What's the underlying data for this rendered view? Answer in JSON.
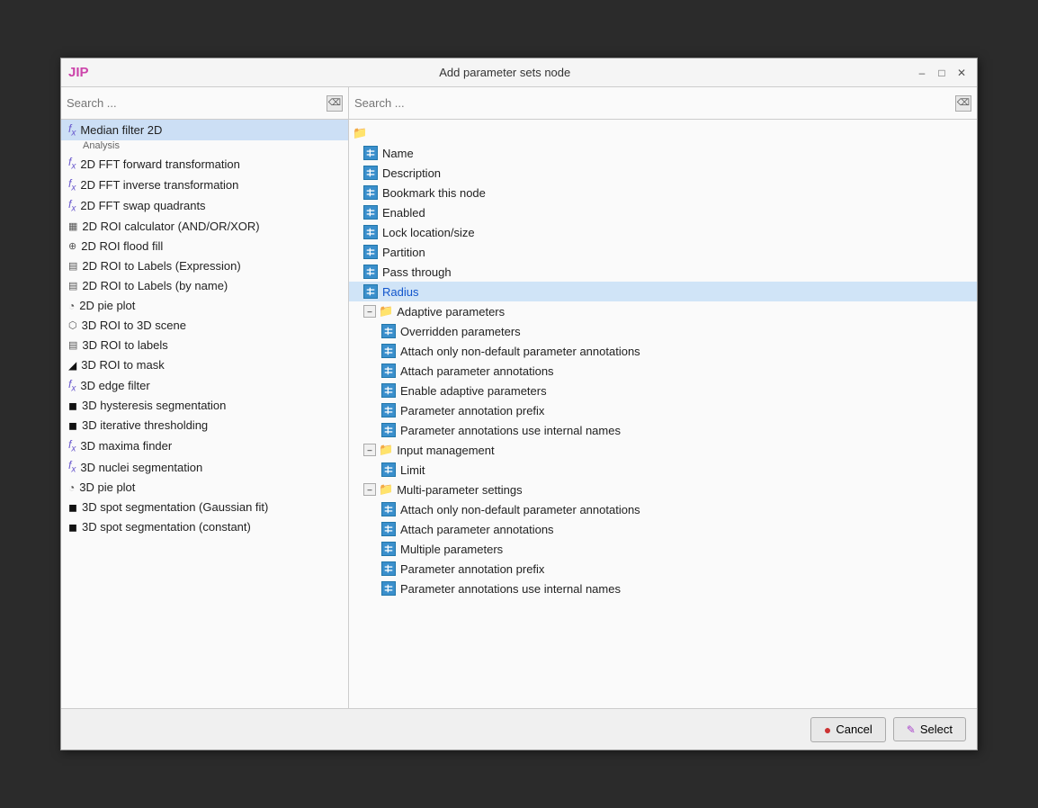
{
  "dialog": {
    "title": "Add parameter sets node",
    "logo": "JIP"
  },
  "titlebar": {
    "minimize_label": "–",
    "maximize_label": "□",
    "close_label": "✕"
  },
  "left_panel": {
    "search_placeholder": "Search ...",
    "items": [
      {
        "id": "median-filter-2d",
        "icon": "fx",
        "label": "Median filter 2D",
        "sub": "Analysis",
        "selected": true
      },
      {
        "id": "2d-fft-forward",
        "icon": "fx",
        "label": "2D FFT forward transformation",
        "sub": null
      },
      {
        "id": "2d-fft-inverse",
        "icon": "fx",
        "label": "2D FFT inverse transformation",
        "sub": null
      },
      {
        "id": "2d-fft-swap",
        "icon": "fx",
        "label": "2D FFT swap quadrants",
        "sub": null
      },
      {
        "id": "2d-roi-calc",
        "icon": "roi",
        "label": "2D ROI calculator (AND/OR/XOR)",
        "sub": null
      },
      {
        "id": "2d-roi-flood",
        "icon": "roi2",
        "label": "2D ROI flood fill",
        "sub": null
      },
      {
        "id": "2d-roi-labels-expr",
        "icon": "roi3",
        "label": "2D ROI to Labels (Expression)",
        "sub": null
      },
      {
        "id": "2d-roi-labels-name",
        "icon": "roi3",
        "label": "2D ROI to Labels (by name)",
        "sub": null
      },
      {
        "id": "2d-pie-plot",
        "icon": "chart",
        "label": "2D pie plot",
        "sub": null
      },
      {
        "id": "3d-roi-scene",
        "icon": "3d",
        "label": "3D ROI to 3D scene",
        "sub": null
      },
      {
        "id": "3d-roi-labels",
        "icon": "roi3",
        "label": "3D ROI to labels",
        "sub": null
      },
      {
        "id": "3d-roi-mask",
        "icon": "black",
        "label": "3D ROI to mask",
        "sub": null
      },
      {
        "id": "3d-edge-filter",
        "icon": "fx",
        "label": "3D edge filter",
        "sub": null
      },
      {
        "id": "3d-hysteresis",
        "icon": "black2",
        "label": "3D hysteresis segmentation",
        "sub": null
      },
      {
        "id": "3d-iterative",
        "icon": "black2",
        "label": "3D iterative thresholding",
        "sub": null
      },
      {
        "id": "3d-maxima",
        "icon": "fx",
        "label": "3D maxima finder",
        "sub": null
      },
      {
        "id": "3d-nuclei",
        "icon": "fx",
        "label": "3D nuclei segmentation",
        "sub": null
      },
      {
        "id": "3d-pie-plot",
        "icon": "chart",
        "label": "3D pie plot",
        "sub": null
      },
      {
        "id": "3d-spot-gaussian",
        "icon": "black2",
        "label": "3D spot segmentation (Gaussian fit)",
        "sub": null
      },
      {
        "id": "3d-spot-constant",
        "icon": "black2",
        "label": "3D spot segmentation (constant)",
        "sub": null
      }
    ]
  },
  "right_panel": {
    "search_placeholder": "Search ...",
    "tree": [
      {
        "type": "root-folder",
        "label": "",
        "level": 0
      },
      {
        "type": "param",
        "label": "Name",
        "level": 1,
        "highlighted": false
      },
      {
        "type": "param",
        "label": "Description",
        "level": 1,
        "highlighted": false
      },
      {
        "type": "param",
        "label": "Bookmark this node",
        "level": 1,
        "highlighted": false
      },
      {
        "type": "param",
        "label": "Enabled",
        "level": 1,
        "highlighted": false
      },
      {
        "type": "param",
        "label": "Lock location/size",
        "level": 1,
        "highlighted": false
      },
      {
        "type": "param",
        "label": "Partition",
        "level": 1,
        "highlighted": false
      },
      {
        "type": "param",
        "label": "Pass through",
        "level": 1,
        "highlighted": false
      },
      {
        "type": "param",
        "label": "Radius",
        "level": 1,
        "highlighted": true
      },
      {
        "type": "folder",
        "label": "Adaptive parameters",
        "level": 1,
        "collapsed": false
      },
      {
        "type": "param",
        "label": "Overridden parameters",
        "level": 2,
        "highlighted": false
      },
      {
        "type": "param",
        "label": "Attach only non-default parameter annotations",
        "level": 2,
        "highlighted": false
      },
      {
        "type": "param",
        "label": "Attach parameter annotations",
        "level": 2,
        "highlighted": false
      },
      {
        "type": "param",
        "label": "Enable adaptive parameters",
        "level": 2,
        "highlighted": false
      },
      {
        "type": "param",
        "label": "Parameter annotation prefix",
        "level": 2,
        "highlighted": false
      },
      {
        "type": "param",
        "label": "Parameter annotations use internal names",
        "level": 2,
        "highlighted": false
      },
      {
        "type": "folder",
        "label": "Input management",
        "level": 1,
        "collapsed": false
      },
      {
        "type": "param",
        "label": "Limit",
        "level": 2,
        "highlighted": false
      },
      {
        "type": "folder",
        "label": "Multi-parameter settings",
        "level": 1,
        "collapsed": false
      },
      {
        "type": "param",
        "label": "Attach only non-default parameter annotations",
        "level": 2,
        "highlighted": false
      },
      {
        "type": "param",
        "label": "Attach parameter annotations",
        "level": 2,
        "highlighted": false
      },
      {
        "type": "param",
        "label": "Multiple parameters",
        "level": 2,
        "highlighted": false
      },
      {
        "type": "param",
        "label": "Parameter annotation prefix",
        "level": 2,
        "highlighted": false
      },
      {
        "type": "param",
        "label": "Parameter annotations use internal names",
        "level": 2,
        "highlighted": false
      }
    ]
  },
  "footer": {
    "cancel_label": "Cancel",
    "select_label": "Select",
    "cancel_icon": "✕",
    "select_icon": "✎"
  }
}
